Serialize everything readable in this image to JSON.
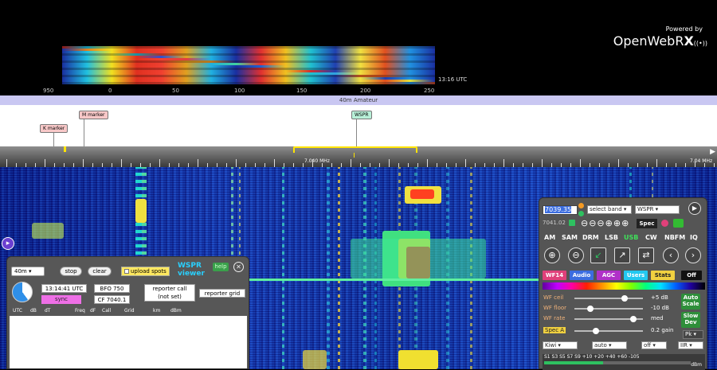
{
  "branding": {
    "powered_by": "Powered by",
    "name_main": "OpenWebR",
    "name_bold": "X",
    "signal_glyph": "((•))"
  },
  "mini_waterfall": {
    "time": "13:16 UTC",
    "scale_labels": [
      "950",
      "0",
      "50",
      "100",
      "150",
      "200",
      "250"
    ]
  },
  "band": {
    "name": "40m Amateur",
    "color": "#c9c7f2"
  },
  "bookmarks": [
    {
      "label": "K marker",
      "color": "#f8c8c8"
    },
    {
      "label": "M marker",
      "color": "#f8c8c8"
    },
    {
      "label": "WSPR",
      "color": "#b8f0d8"
    }
  ],
  "scale": {
    "center_label": "7.040 MHz",
    "right_label": "7.04 MHz",
    "right_arrow": "▶",
    "accent": "#ffe400"
  },
  "side_toggle": {
    "glyph": "▸"
  },
  "wspr": {
    "band_select": "40m ▾",
    "stop_label": "stop",
    "clear_label": "clear",
    "upload_label": "upload spots",
    "title_line1": "WSPR",
    "title_line2": "viewer",
    "help_label": "help",
    "close_glyph": "✕",
    "time": "13:14:41 UTC",
    "sync_label": "sync",
    "bfo": "BFO 750",
    "cf": "CF 7040.1",
    "reporter_call": "reporter call",
    "reporter_call_value": "(not set)",
    "reporter_grid": "reporter grid",
    "columns": [
      "UTC",
      "dB",
      "dT",
      "Freq",
      "dF",
      "Call",
      "Grid",
      "km",
      "dBm"
    ]
  },
  "rx": {
    "freq_value": "7039.35",
    "freq_small": "7041.02",
    "band_select": "select band ▾",
    "ext_select": "WSPR ▾",
    "spec_label": "Spec",
    "modes": [
      "AM",
      "SAM",
      "DRM",
      "LSB",
      "USB",
      "CW",
      "NBFM",
      "IQ"
    ],
    "active_mode": "USB",
    "chips": [
      {
        "label": "WF14",
        "bg": "#e0407a",
        "fg": "#fff"
      },
      {
        "label": "Audio",
        "bg": "#3b6de0",
        "fg": "#fff"
      },
      {
        "label": "AGC",
        "bg": "#b030c8",
        "fg": "#fff"
      },
      {
        "label": "Users",
        "bg": "#23c8f0",
        "fg": "#fff"
      },
      {
        "label": "Stats",
        "bg": "#f0d040",
        "fg": "#222"
      },
      {
        "label": "Off",
        "bg": "#111",
        "fg": "#fff"
      }
    ],
    "sliders": [
      {
        "label": "WF ceil",
        "value": "+5 dB",
        "level": 0.75
      },
      {
        "label": "WF floor",
        "value": "-10 dB",
        "level": 0.2
      },
      {
        "label": "WF rate",
        "value": "med",
        "level": 0.9
      },
      {
        "label": "Spec A",
        "value": "0.2 gain",
        "level": 0.3
      }
    ],
    "auto_scale": "Auto Scale",
    "slow_dev": "Slow Dev",
    "pk_select": "Pk ▾",
    "bottom_selects": [
      "Kiwi ▾",
      "auto ▾",
      "off ▾",
      "IIR ▾"
    ],
    "smeter_labels": "S1  S3  S5  S7  S9 +10 +20  +40  +60 -105",
    "smeter_unit": "dBm"
  }
}
